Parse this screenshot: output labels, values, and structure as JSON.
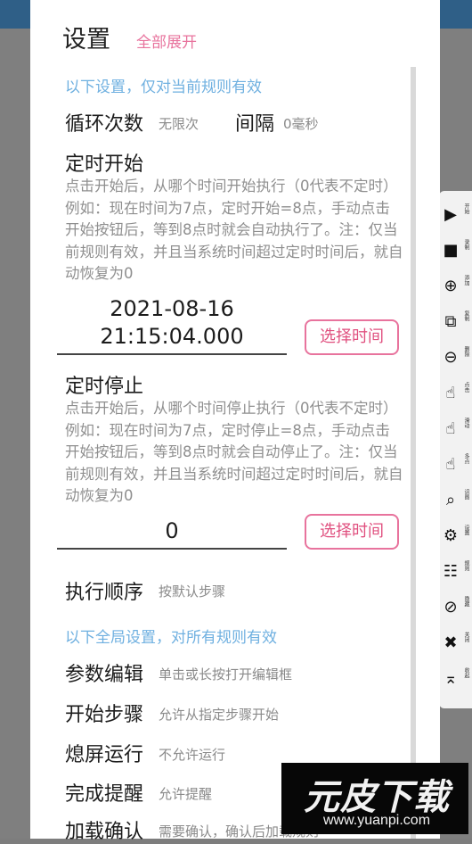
{
  "dialog": {
    "title": "设置",
    "expand_all": "全部展开",
    "rule_scope_hint": "以下设置，仅对当前规则有效",
    "global_scope_hint": "以下全局设置，对所有规则有效"
  },
  "loop": {
    "label": "循环次数",
    "value": "无限次",
    "interval_label": "间隔",
    "interval_value": "0毫秒"
  },
  "timed_start": {
    "label": "定时开始",
    "description": "点击开始后，从哪个时间开始执行（0代表不定时）例如：现在时间为7点，定时开始=8点，手动点击开始按钮后，等到8点时就会自动执行了。注：仅当前规则有效，并且当系统时间超过定时时间后，就自动恢复为0",
    "date": "2021-08-16",
    "time": "21:15:04.000",
    "button": "选择时间"
  },
  "timed_stop": {
    "label": "定时停止",
    "description": "点击开始后，从哪个时间停止执行（0代表不定时）例如：现在时间为7点，定时停止=8点，手动点击开始按钮后，等到8点时就会自动停止了。注：仅当前规则有效，并且当系统时间超过定时时间后，就自动恢复为0",
    "value": "0",
    "button": "选择时间"
  },
  "exec_order": {
    "label": "执行顺序",
    "value": "按默认步骤"
  },
  "global": [
    {
      "label": "参数编辑",
      "value": "单击或长按打开编辑框"
    },
    {
      "label": "开始步骤",
      "value": "允许从指定步骤开始"
    },
    {
      "label": "熄屏运行",
      "value": "不允许运行"
    },
    {
      "label": "完成提醒",
      "value": "允许提醒"
    },
    {
      "label": "加载确认",
      "value": "需要确认，确认后加载规则"
    }
  ],
  "toolbar": [
    {
      "icon": "play-icon",
      "label": "开始"
    },
    {
      "icon": "record-icon",
      "label": "录制"
    },
    {
      "icon": "add-icon",
      "label": "添加"
    },
    {
      "icon": "copy-icon",
      "label": "复制"
    },
    {
      "icon": "remove-icon",
      "label": "删除"
    },
    {
      "icon": "tap-icon",
      "label": "点击"
    },
    {
      "icon": "swipe-icon",
      "label": "滑动"
    },
    {
      "icon": "multitouch-icon",
      "label": "多点"
    },
    {
      "icon": "recognize-icon",
      "label": "识图"
    },
    {
      "icon": "settings-icon",
      "label": "设置"
    },
    {
      "icon": "rules-icon",
      "label": "规则"
    },
    {
      "icon": "hide-icon",
      "label": "隐藏"
    },
    {
      "icon": "close-icon",
      "label": "关闭"
    },
    {
      "icon": "collapse-icon",
      "label": "收起"
    }
  ],
  "watermark": {
    "title": "元皮下载",
    "url": "www.yuanpi.com"
  }
}
